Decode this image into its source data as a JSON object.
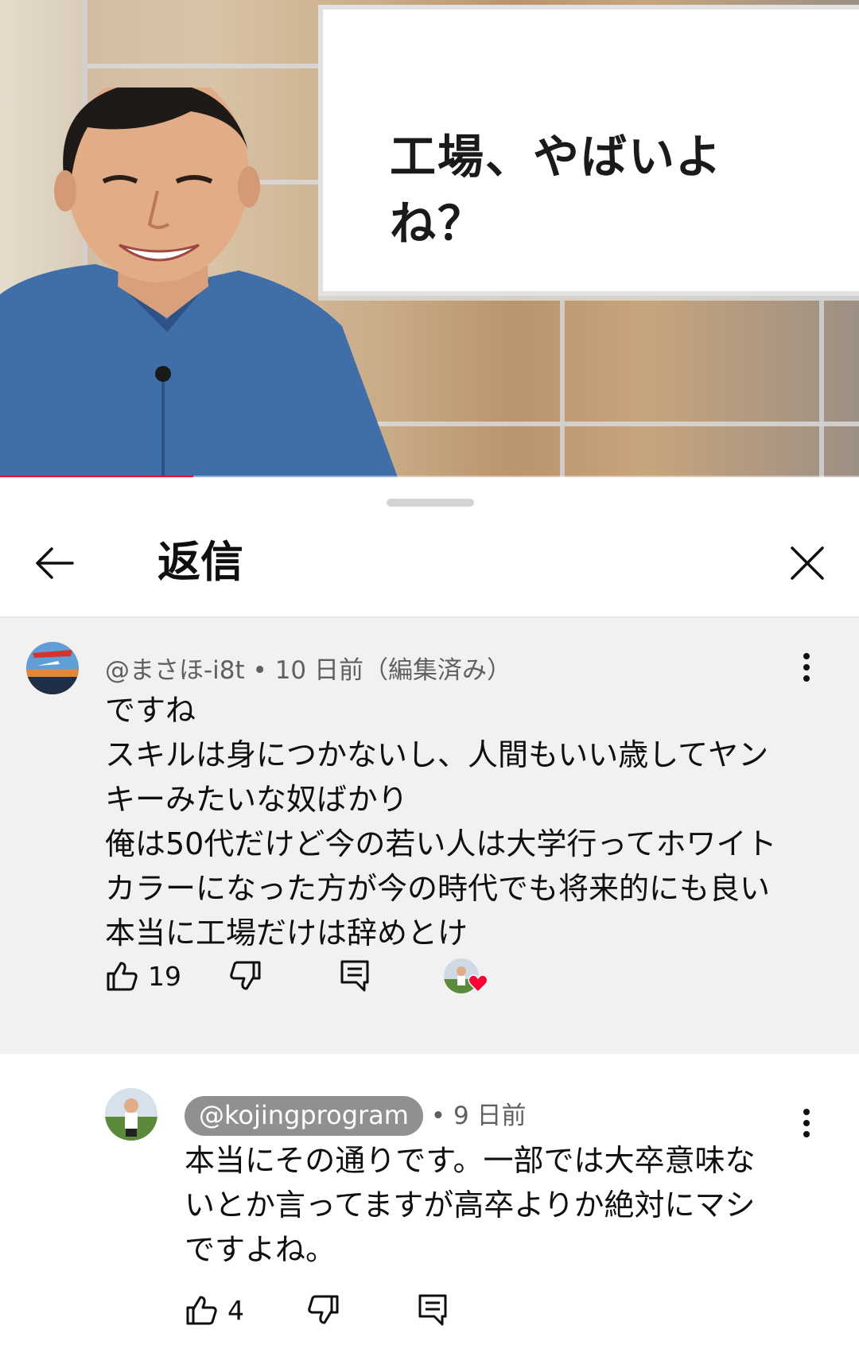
{
  "video": {
    "whiteboard_text": "工場、やばいよね？",
    "progress_fraction": 0.225
  },
  "sheet": {
    "title": "返信"
  },
  "parent_comment": {
    "author": "@まさほ-i8t",
    "age": "10 日前（編集済み）",
    "lines": [
      "ですね",
      "スキルは身につかないし、人間もいい歳してヤン",
      "キーみたいな奴ばかり",
      "俺は50代だけど今の若い人は大学行ってホワイト",
      "カラーになった方が今の時代でも将来的にも良い",
      "本当に工場だけは辞めとけ"
    ],
    "likes": "19"
  },
  "reply": {
    "author": "@kojingprogram",
    "age": "9 日前",
    "lines": [
      "本当にその通りです。一部では大卒意味な",
      "いとか言ってますが高卒よりか絶対にマシ",
      "ですよね。"
    ],
    "likes": "4"
  },
  "colors": {
    "progress": "#ff0033",
    "heart": "#ff0033",
    "comment_bg": "#f1f1f1",
    "chip_bg": "#909090"
  },
  "icons": [
    "back-arrow-icon",
    "close-icon",
    "more-vert-icon",
    "thumb-up-icon",
    "thumb-down-icon",
    "reply-icon",
    "heart-icon"
  ]
}
